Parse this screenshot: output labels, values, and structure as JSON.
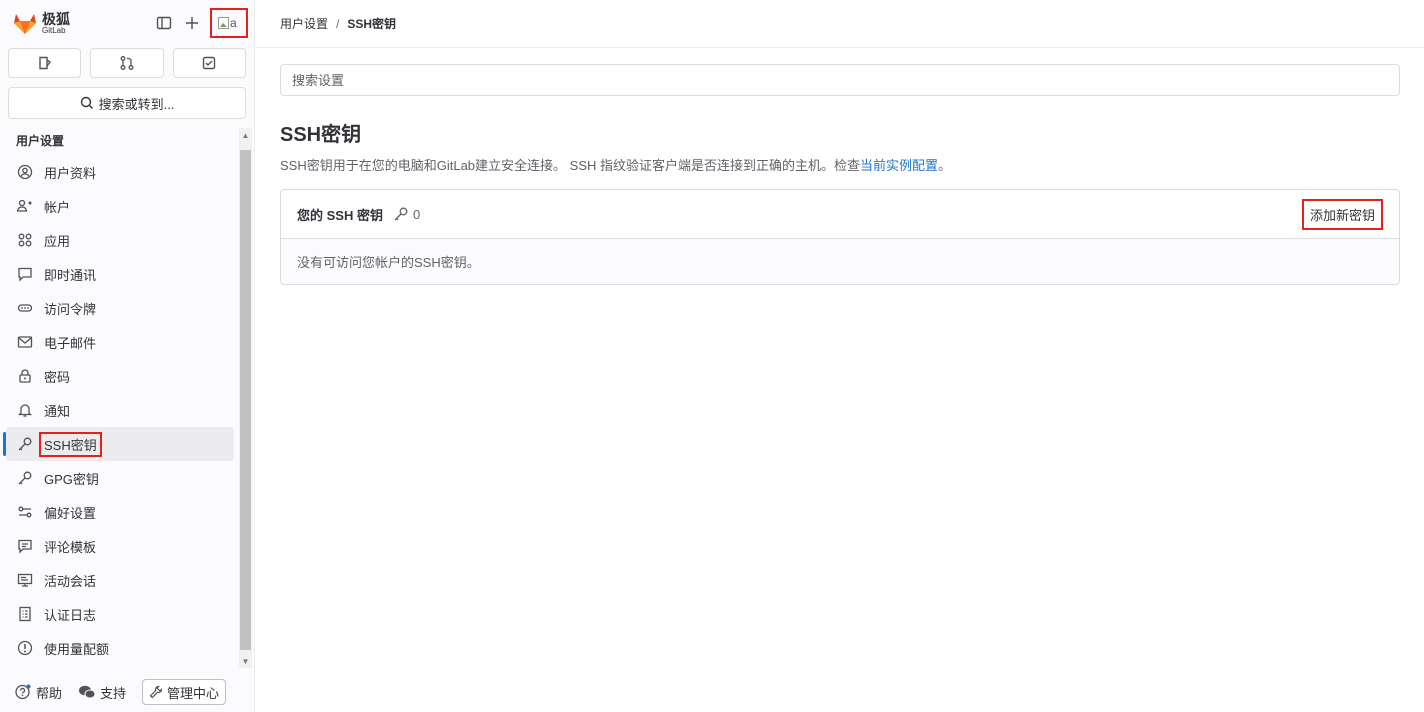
{
  "brand": {
    "name": "极狐",
    "sub": "GitLab"
  },
  "avatar_alt": "a",
  "search_button": "搜索或转到...",
  "sidebar_section": "用户设置",
  "nav_items": [
    {
      "label": "用户资料",
      "icon": "profile-icon"
    },
    {
      "label": "帐户",
      "icon": "account-icon"
    },
    {
      "label": "应用",
      "icon": "applications-icon"
    },
    {
      "label": "即时通讯",
      "icon": "chat-icon"
    },
    {
      "label": "访问令牌",
      "icon": "token-icon"
    },
    {
      "label": "电子邮件",
      "icon": "mail-icon"
    },
    {
      "label": "密码",
      "icon": "lock-icon"
    },
    {
      "label": "通知",
      "icon": "bell-icon"
    },
    {
      "label": "SSH密钥",
      "icon": "key-icon",
      "active": true
    },
    {
      "label": "GPG密钥",
      "icon": "key-icon"
    },
    {
      "label": "偏好设置",
      "icon": "preferences-icon"
    },
    {
      "label": "评论模板",
      "icon": "comment-icon"
    },
    {
      "label": "活动会话",
      "icon": "monitor-icon"
    },
    {
      "label": "认证日志",
      "icon": "log-icon"
    },
    {
      "label": "使用量配额",
      "icon": "quota-icon"
    }
  ],
  "bottom": {
    "help": "帮助",
    "support": "支持",
    "admin": "管理中心"
  },
  "breadcrumb": {
    "parent": "用户设置",
    "separator": "/",
    "current": "SSH密钥"
  },
  "search_settings_placeholder": "搜索设置",
  "page_title": "SSH密钥",
  "description": {
    "text": "SSH密钥用于在您的电脑和GitLab建立安全连接。 SSH 指纹验证客户端是否连接到正确的主机。检查",
    "link": "当前实例配置",
    "end": "。"
  },
  "card": {
    "title": "您的 SSH 密钥",
    "count": "0",
    "add_button": "添加新密钥",
    "empty": "没有可访问您帐户的SSH密钥。"
  },
  "colors": {
    "accent": "#1f75cb",
    "highlight": "#e6201a",
    "brand": "#e24329"
  }
}
